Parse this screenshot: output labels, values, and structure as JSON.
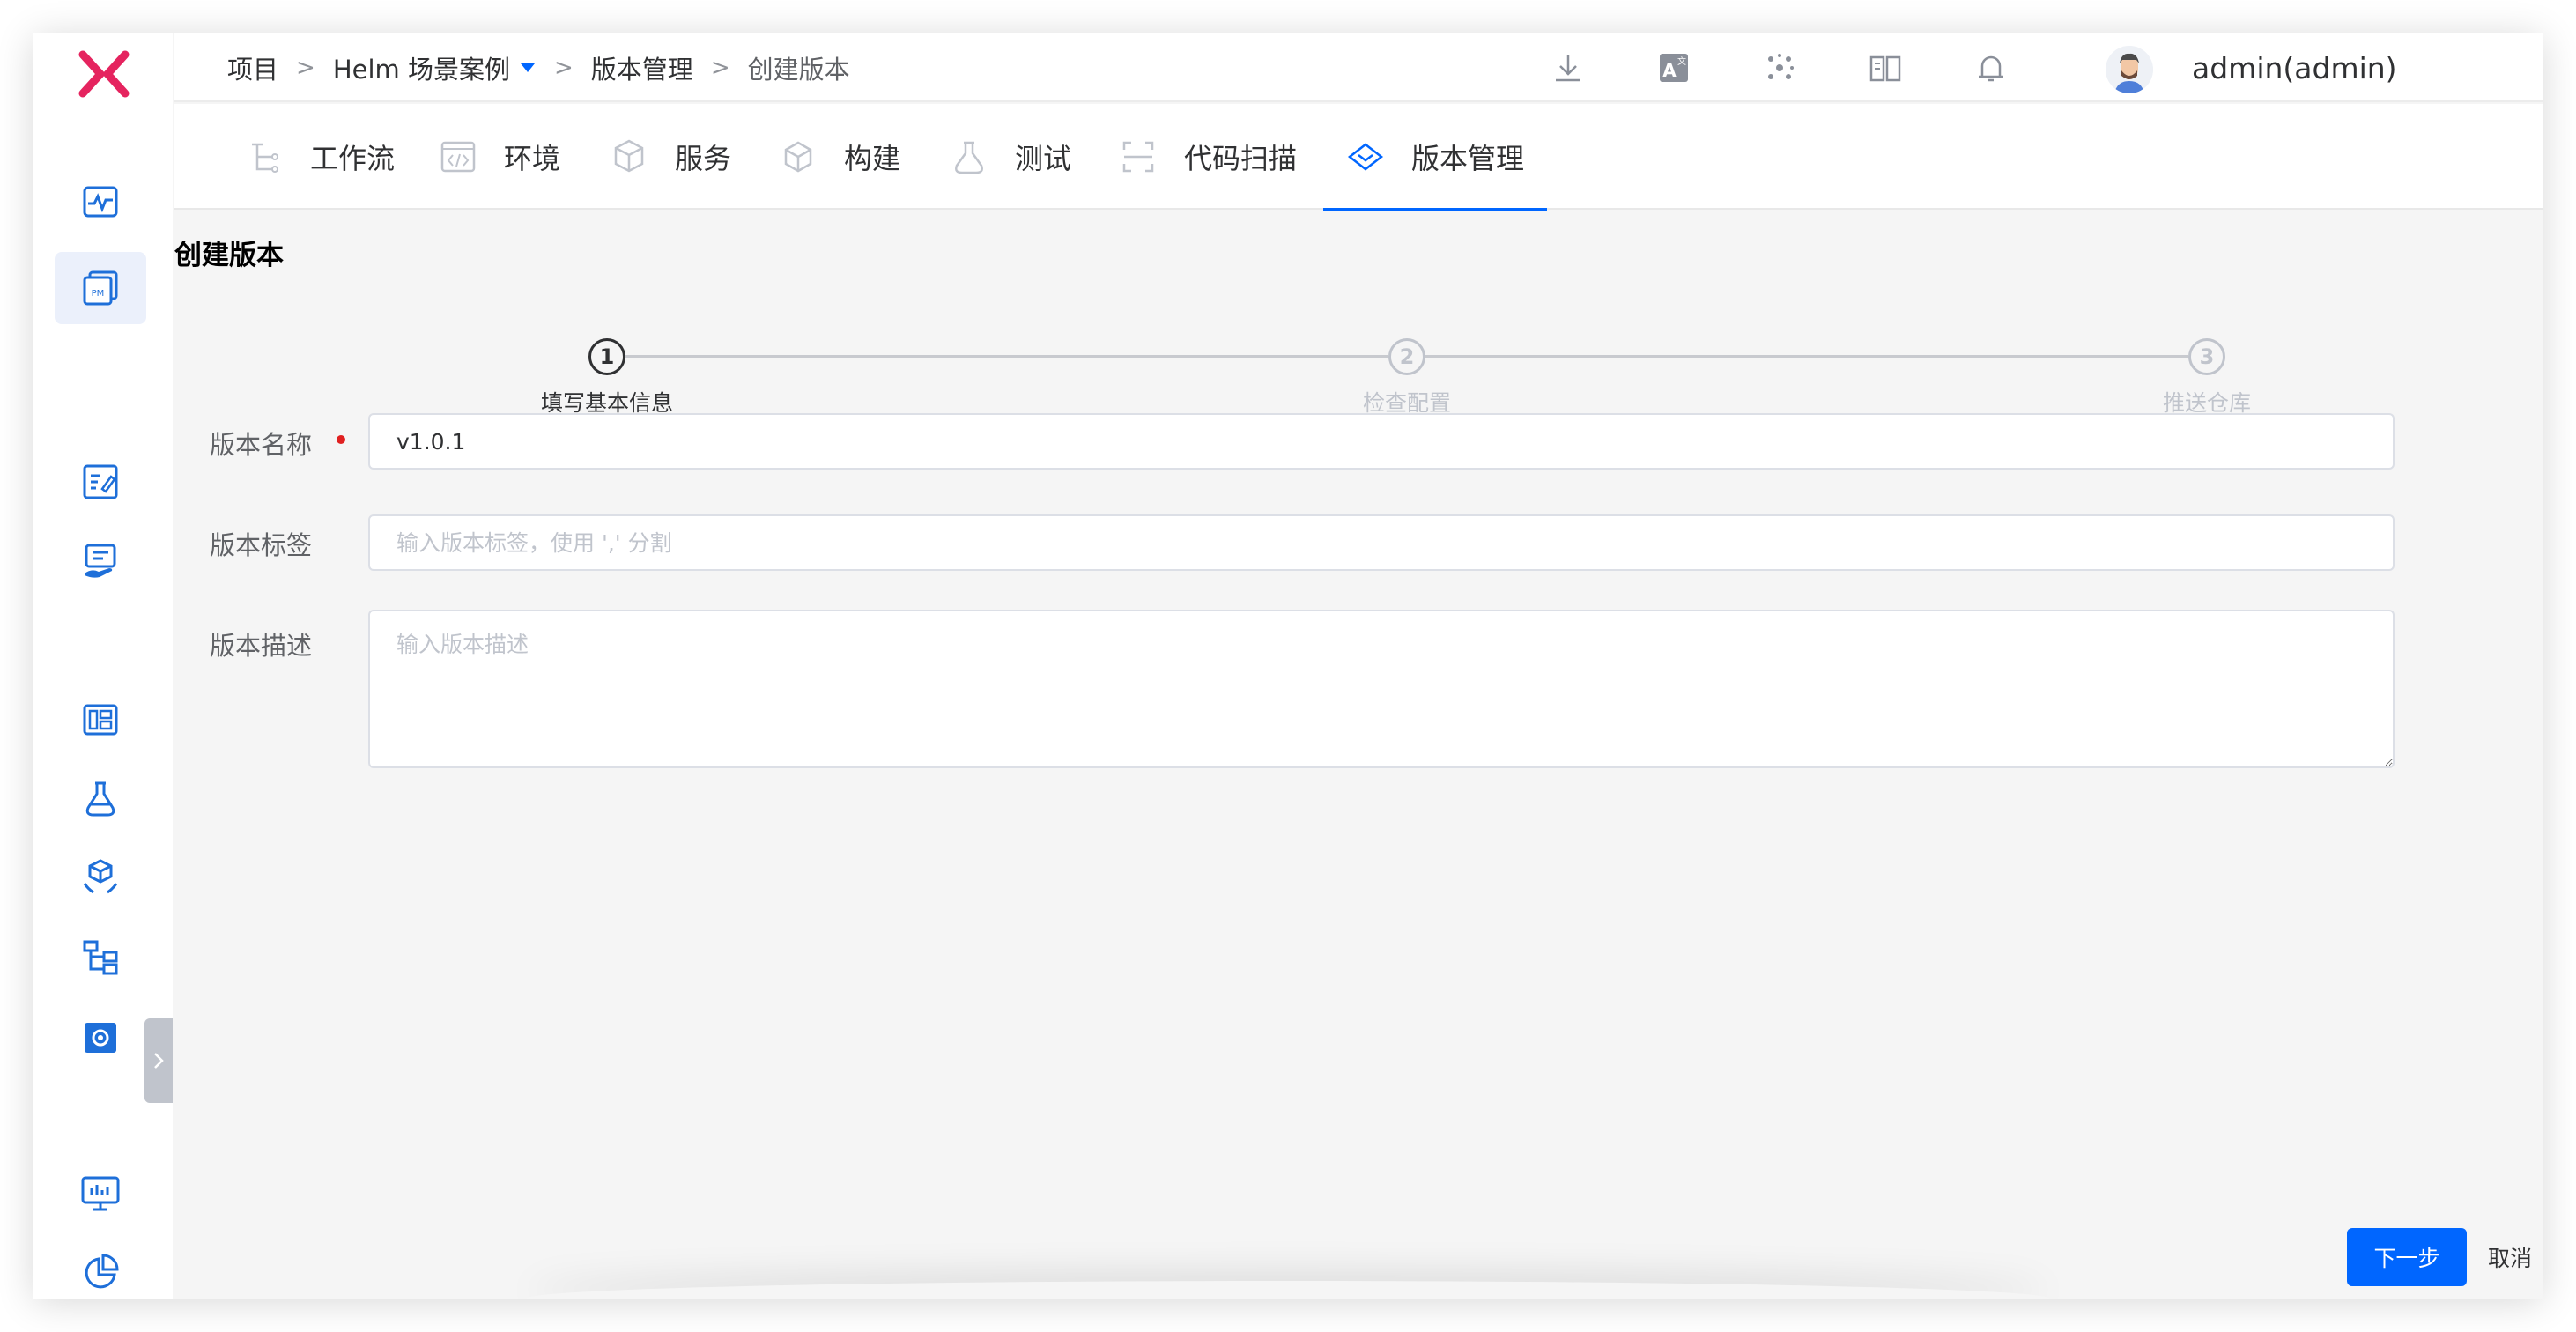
{
  "breadcrumb": {
    "items": [
      "项目",
      "Helm 场景案例",
      "版本管理",
      "创建版本"
    ],
    "separator": ">"
  },
  "user": {
    "name": "admin(admin)"
  },
  "tabs": [
    {
      "label": "工作流",
      "icon": "workflow-icon"
    },
    {
      "label": "环境",
      "icon": "environment-code-icon"
    },
    {
      "label": "服务",
      "icon": "service-cube-icon"
    },
    {
      "label": "构建",
      "icon": "build-box-icon"
    },
    {
      "label": "测试",
      "icon": "test-flask-icon"
    },
    {
      "label": "代码扫描",
      "icon": "scan-icon"
    },
    {
      "label": "版本管理",
      "icon": "version-diamond-icon",
      "active": true
    }
  ],
  "page": {
    "title": "创建版本"
  },
  "steps": [
    {
      "number": "1",
      "label": "填写基本信息",
      "active": true
    },
    {
      "number": "2",
      "label": "检查配置",
      "active": false
    },
    {
      "number": "3",
      "label": "推送仓库",
      "active": false
    }
  ],
  "form": {
    "name": {
      "label": "版本名称",
      "value": "v1.0.1",
      "required": true
    },
    "tags": {
      "label": "版本标签",
      "placeholder": "输入版本标签，使用 ',' 分割"
    },
    "description": {
      "label": "版本描述",
      "placeholder": "输入版本描述"
    }
  },
  "actions": {
    "next": "下一步",
    "cancel": "取消"
  },
  "colors": {
    "accent": "#0066ff",
    "logo": "#e5245f",
    "required": "#e02020",
    "sidebar_icon": "#1e6fd9"
  }
}
